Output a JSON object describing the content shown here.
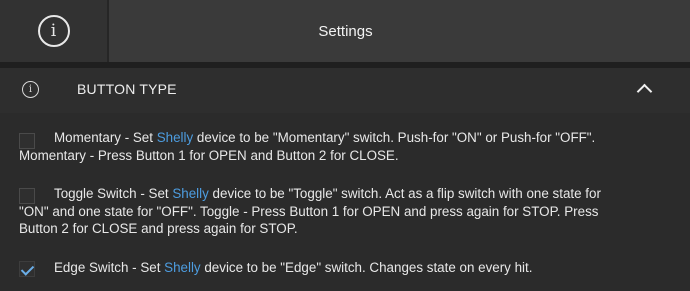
{
  "header": {
    "title": "Settings",
    "info_icon": "info-icon"
  },
  "section": {
    "title": "BUTTON TYPE",
    "info_icon": "info-icon",
    "collapse_icon": "chevron-up-icon"
  },
  "colors": {
    "accent": "#4d9de0",
    "check": "#6aaee8"
  },
  "options": [
    {
      "checked": false,
      "pre": "Momentary - Set ",
      "brand": "Shelly",
      "post": " device to be \"Momentary\" switch. Push-for \"ON\" or Push-for \"OFF\".",
      "line2": "Momentary - Press Button 1 for OPEN and Button 2 for CLOSE."
    },
    {
      "checked": false,
      "pre": "Toggle Switch - Set ",
      "brand": "Shelly",
      "post": " device to be \"Toggle\" switch. Act as a flip switch with one state for \"ON\" and one state for \"OFF\". Toggle - Press Button 1 for OPEN and press again for STOP. Press Button 2 for CLOSE and press again for STOP.",
      "line2": ""
    },
    {
      "checked": true,
      "pre": "Edge Switch - Set ",
      "brand": "Shelly",
      "post": " device to be \"Edge\" switch. Changes state on every hit.",
      "line2": ""
    }
  ]
}
